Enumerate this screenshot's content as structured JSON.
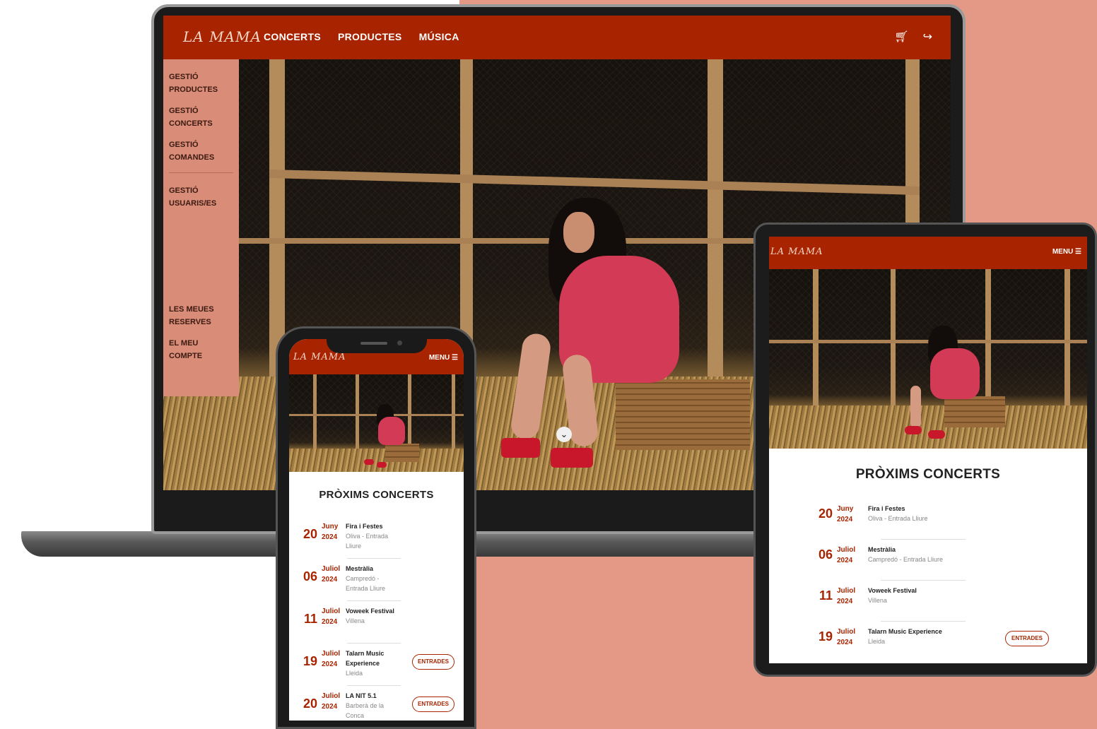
{
  "brand": {
    "logo_text": "LA MAMA"
  },
  "desktop": {
    "nav": {
      "links": [
        "CONCERTS",
        "PRODUCTES",
        "MÚSICA"
      ],
      "cart_icon": "cart-icon",
      "logout_icon": "logout-icon"
    },
    "sidebar": {
      "items": [
        "GESTIÓ PRODUCTES",
        "GESTIÓ CONCERTS",
        "GESTIÓ COMANDES",
        "GESTIÓ USUARIS/ES"
      ],
      "bottom_items": [
        "LES MEUES RESERVES",
        "EL MEU COMPTE"
      ]
    },
    "scroll_icon": "chevron-down-icon"
  },
  "tablet": {
    "menu_label": "MENU ☰",
    "section_title": "PRÒXIMS CONCERTS",
    "concerts": [
      {
        "day": "20",
        "month": "Juny",
        "year": "2024",
        "name": "Fira i Festes",
        "place": "Oliva - Entrada Lliure",
        "button": ""
      },
      {
        "day": "06",
        "month": "Juliol",
        "year": "2024",
        "name": "Mestràlia",
        "place": "Campredó - Entrada Lliure",
        "button": ""
      },
      {
        "day": "11",
        "month": "Juliol",
        "year": "2024",
        "name": "Voweek Festival",
        "place": "Villena",
        "button": ""
      },
      {
        "day": "19",
        "month": "Juliol",
        "year": "2024",
        "name": "Talarn Music Experience",
        "place": "Lleida",
        "button": "ENTRADES"
      }
    ]
  },
  "phone": {
    "menu_label": "MENU ☰",
    "section_title": "PRÒXIMS CONCERTS",
    "concerts": [
      {
        "day": "20",
        "month": "Juny",
        "year": "2024",
        "name": "Fira i Festes",
        "place": "Oliva - Entrada Lliure",
        "button": ""
      },
      {
        "day": "06",
        "month": "Juliol",
        "year": "2024",
        "name": "Mestràlia",
        "place": "Campredó - Entrada Lliure",
        "button": ""
      },
      {
        "day": "11",
        "month": "Juliol",
        "year": "2024",
        "name": "Voweek Festival",
        "place": "Villena",
        "button": ""
      },
      {
        "day": "19",
        "month": "Juliol",
        "year": "2024",
        "name": "Talarn Music Experience",
        "place": "Lleida",
        "button": "ENTRADES"
      },
      {
        "day": "20",
        "month": "Juliol",
        "year": "2024",
        "name": "LA NIT 5.1",
        "place": "Barberà de la Conca",
        "button": "ENTRADES"
      }
    ]
  },
  "colors": {
    "brand_red": "#a82400",
    "sidebar_salmon": "#d98c77",
    "background_salmon": "#e49886"
  }
}
